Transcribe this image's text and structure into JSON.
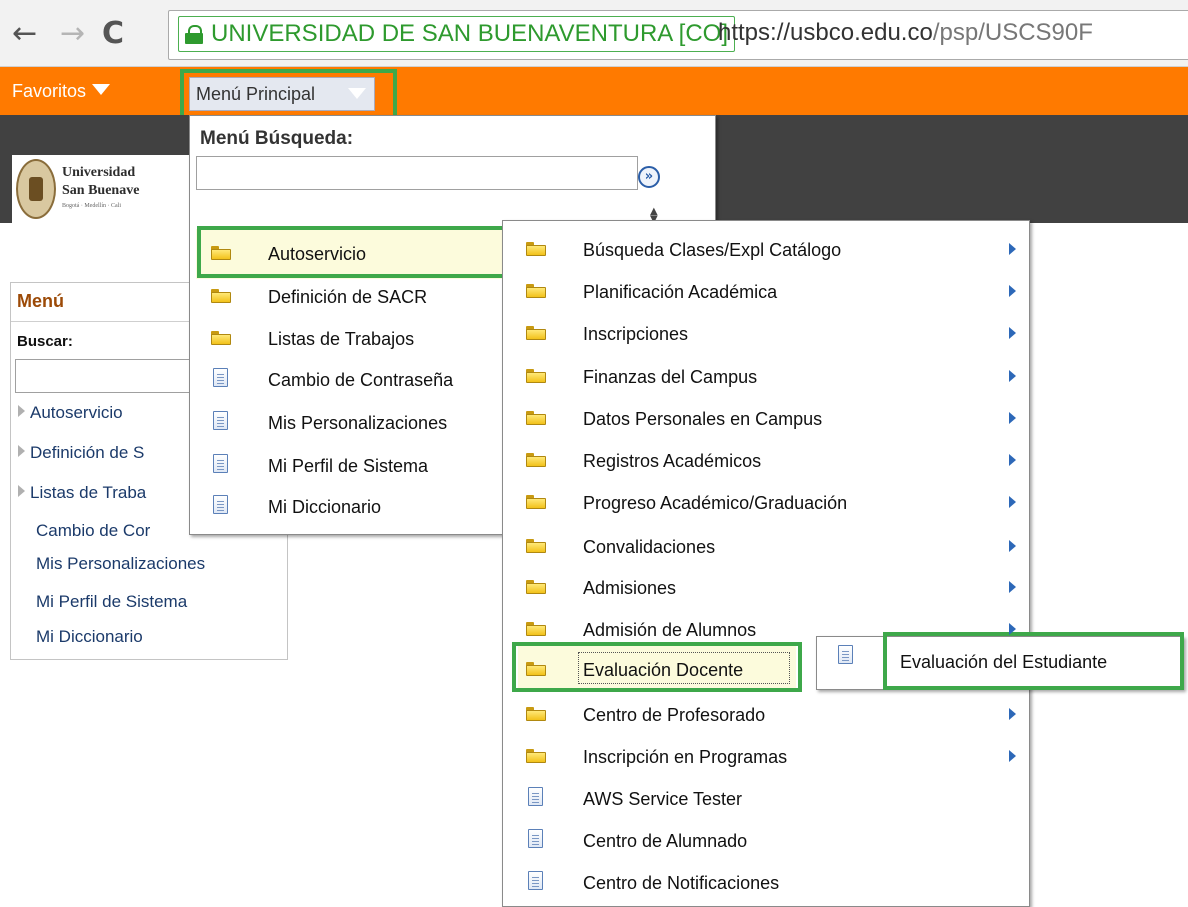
{
  "browser": {
    "ev_label": "UNIVERSIDAD DE SAN BUENAVENTURA [CO]",
    "url_scheme": "https://",
    "url_host": "usbco.edu.co",
    "url_path": "/psp/USCS90F"
  },
  "menubar": {
    "favorites_label": "Favoritos",
    "main_menu_label": "Menú Principal"
  },
  "logo": {
    "line1": "Universidad",
    "line2": "San Buenave",
    "line3": "Bogotá · Medellín · Cali"
  },
  "left_panel": {
    "title": "Menú",
    "search_label": "Buscar:",
    "items": [
      {
        "label": "Autoservicio",
        "expandable": true
      },
      {
        "label": "Definición de S",
        "expandable": true
      },
      {
        "label": "Listas de Traba",
        "expandable": true
      },
      {
        "label": "Cambio de Cor",
        "expandable": false
      },
      {
        "label": "Mis Personalizaciones",
        "expandable": false
      },
      {
        "label": "Mi Perfil de Sistema",
        "expandable": false
      },
      {
        "label": "Mi Diccionario",
        "expandable": false
      }
    ]
  },
  "menu_level1": {
    "search_title": "Menú Búsqueda:",
    "go_glyph": "»",
    "items": [
      {
        "label": "Autoservicio",
        "icon": "folder",
        "highlighted": true
      },
      {
        "label": "Definición de SACR",
        "icon": "folder"
      },
      {
        "label": "Listas de Trabajos",
        "icon": "folder"
      },
      {
        "label": "Cambio de Contraseña",
        "icon": "document"
      },
      {
        "label": "Mis Personalizaciones",
        "icon": "document"
      },
      {
        "label": "Mi Perfil de Sistema",
        "icon": "document"
      },
      {
        "label": "Mi Diccionario",
        "icon": "document"
      }
    ]
  },
  "menu_level2": {
    "items": [
      {
        "label": "Búsqueda Clases/Expl Catálogo",
        "icon": "folder",
        "submenu": true
      },
      {
        "label": "Planificación Académica",
        "icon": "folder",
        "submenu": true
      },
      {
        "label": "Inscripciones",
        "icon": "folder",
        "submenu": true
      },
      {
        "label": "Finanzas del Campus",
        "icon": "folder",
        "submenu": true
      },
      {
        "label": "Datos Personales en Campus",
        "icon": "folder",
        "submenu": true
      },
      {
        "label": "Registros Académicos",
        "icon": "folder",
        "submenu": true
      },
      {
        "label": "Progreso Académico/Graduación",
        "icon": "folder",
        "submenu": true
      },
      {
        "label": "Convalidaciones",
        "icon": "folder",
        "submenu": true
      },
      {
        "label": "Admisiones",
        "icon": "folder",
        "submenu": true
      },
      {
        "label": "Admisión de Alumnos",
        "icon": "folder",
        "submenu": true
      },
      {
        "label": "Evaluación Docente",
        "icon": "folder",
        "submenu": false,
        "highlighted": true
      },
      {
        "label": "Centro de Profesorado",
        "icon": "folder",
        "submenu": true
      },
      {
        "label": "Inscripción en Programas",
        "icon": "folder",
        "submenu": true
      },
      {
        "label": "AWS Service Tester",
        "icon": "document",
        "submenu": false
      },
      {
        "label": "Centro de Alumnado",
        "icon": "document",
        "submenu": false
      },
      {
        "label": "Centro de Notificaciones",
        "icon": "document",
        "submenu": false
      }
    ]
  },
  "menu_level3": {
    "items": [
      {
        "label": "Evaluación del Estudiante",
        "icon": "document"
      }
    ]
  },
  "colors": {
    "orange_bar": "#ff7a00",
    "dark_header": "#414141",
    "highlight_box": "#3ea84a",
    "hover_bg": "#fcfbdc",
    "ev_green": "#2e9a2e"
  }
}
